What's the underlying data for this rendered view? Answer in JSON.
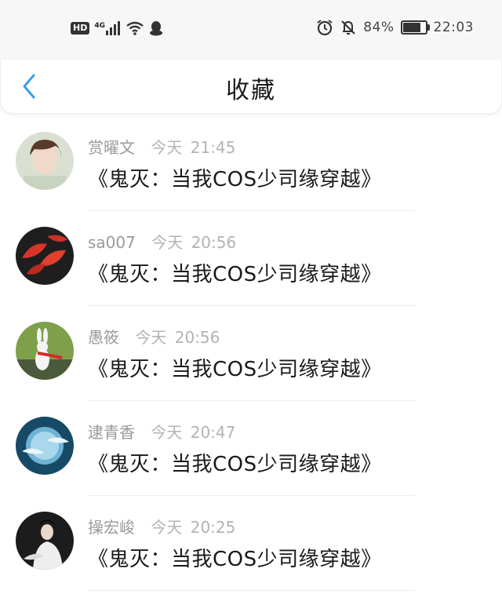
{
  "status_bar": {
    "hd_label": "HD",
    "network_label": "4G",
    "battery_percent": "84%",
    "battery_level": 0.84,
    "time": "22:03",
    "icons": [
      "hd-icon",
      "signal-icon",
      "wifi-icon",
      "qq-icon",
      "alarm-icon",
      "mute-icon",
      "battery-icon"
    ]
  },
  "header": {
    "title": "收藏",
    "back_icon": "chevron-left-icon",
    "accent_color": "#3a9ee8"
  },
  "favorites": [
    {
      "name": "赏曜文",
      "date": "今天",
      "time": "21:45",
      "content": "《鬼灭：当我COS少司缘穿越》",
      "avatar_color": "#cfd8c8"
    },
    {
      "name": "sa007",
      "date": "今天",
      "time": "20:56",
      "content": "《鬼灭：当我COS少司缘穿越》",
      "avatar_color": "#c62a2a"
    },
    {
      "name": "愚筱",
      "date": "今天",
      "time": "20:56",
      "content": "《鬼灭：当我COS少司缘穿越》",
      "avatar_color": "#6a8f3a"
    },
    {
      "name": "逮青香",
      "date": "今天",
      "time": "20:47",
      "content": "《鬼灭：当我COS少司缘穿越》",
      "avatar_color": "#1f5a7a"
    },
    {
      "name": "操宏峻",
      "date": "今天",
      "time": "20:25",
      "content": "《鬼灭：当我COS少司缘穿越》",
      "avatar_color": "#2a2a2a"
    }
  ]
}
